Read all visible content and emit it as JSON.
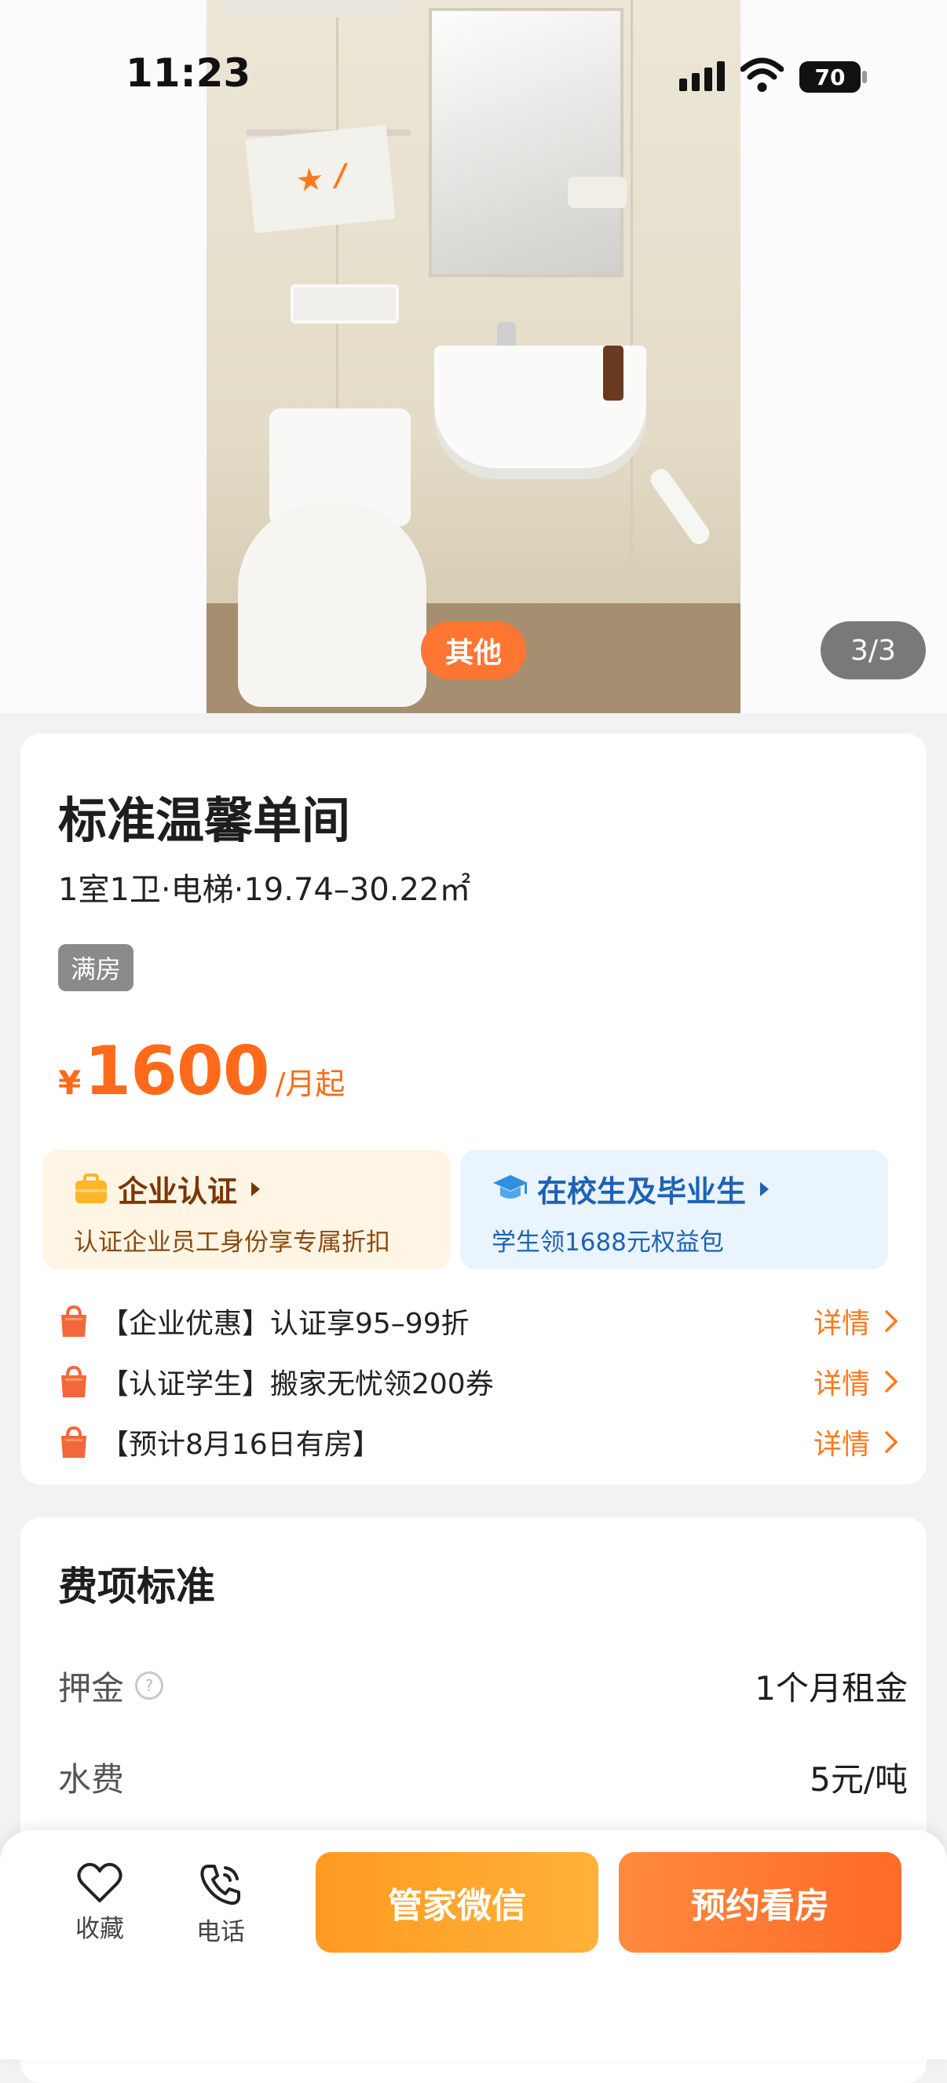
{
  "status_bar": {
    "time": "11:23",
    "battery": "70"
  },
  "gallery": {
    "tag": "其他",
    "counter": "3/3"
  },
  "room": {
    "title": "标准温馨单间",
    "specs": "1室1卫·电梯·19.74–30.22㎡",
    "status_badge": "满房",
    "price": {
      "currency": "¥",
      "value": "1600",
      "unit": "/月起"
    },
    "promos": [
      {
        "title": "企业认证",
        "subtitle": "认证企业员工身份享专属折扣",
        "icon": "briefcase-icon"
      },
      {
        "title": "在校生及毕业生",
        "subtitle": "学生领1688元权益包",
        "icon": "graduation-cap-icon"
      }
    ],
    "offers": [
      {
        "text": "【企业优惠】认证享95–99折",
        "link": "详情"
      },
      {
        "text": "【认证学生】搬家无忧领200券",
        "link": "详情"
      },
      {
        "text": "【预计8月16日有房】",
        "link": "详情"
      }
    ]
  },
  "fees": {
    "title": "费项标准",
    "rows": [
      {
        "label": "押金",
        "value": "1个月租金",
        "has_help": true
      },
      {
        "label": "水费",
        "value": "5元/吨",
        "has_help": false
      }
    ]
  },
  "bottom_bar": {
    "favorite_label": "收藏",
    "phone_label": "电话",
    "wechat_button": "管家微信",
    "book_button": "预约看房"
  },
  "colors": {
    "accent": "#ff6a1a",
    "promo_business_bg": "#fff5e5",
    "promo_student_bg": "#e9f4fc",
    "student_blue": "#1d62b6"
  }
}
